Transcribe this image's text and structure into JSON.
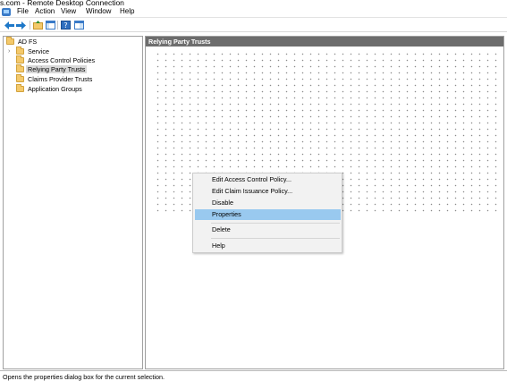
{
  "window": {
    "title": "s.com - Remote Desktop Connection"
  },
  "menubar": {
    "items": [
      "File",
      "Action",
      "View",
      "Window",
      "Help"
    ]
  },
  "toolbar": {
    "buttons": [
      "back-arrow-icon",
      "forward-arrow-icon",
      "up-folder-icon",
      "show-hide-tree-icon",
      "help-icon",
      "action-pane-icon"
    ]
  },
  "tree": {
    "root": "AD FS",
    "items": [
      "Service",
      "Access Control Policies",
      "Relying Party Trusts",
      "Claims Provider Trusts",
      "Application Groups"
    ],
    "selected": "Relying Party Trusts"
  },
  "main": {
    "header": "Relying Party Trusts"
  },
  "context_menu": {
    "items": [
      "Edit Access Control Policy...",
      "Edit Claim Issuance Policy...",
      "Disable",
      "Properties",
      "Delete",
      "Help"
    ],
    "highlighted": "Properties"
  },
  "status": {
    "text": "Opens the properties dialog box for the current selection."
  },
  "colors": {
    "highlight": "#99c9ef",
    "header_bg": "#6d6d6d",
    "folder": "#f4c96b"
  }
}
